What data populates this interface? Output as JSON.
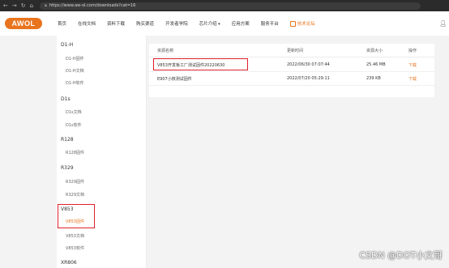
{
  "browser": {
    "url": "https://www.aw-ol.com/downloads?cat=16",
    "nav_icons": [
      "back-icon",
      "forward-icon",
      "reload-icon",
      "home-icon"
    ]
  },
  "header": {
    "logo_text": "AWOL",
    "nav": [
      {
        "label": "首页"
      },
      {
        "label": "在线文档"
      },
      {
        "label": "资料下载"
      },
      {
        "label": "购买渠道"
      },
      {
        "label": "开发者学院"
      },
      {
        "label": "芯片介绍"
      },
      {
        "label": "应用方案"
      },
      {
        "label": "服务平台"
      }
    ],
    "forum_label": "技术论坛",
    "accent": "#e8741e"
  },
  "sidebar": {
    "groups": [
      {
        "label": "D1-H",
        "items": [
          "D1-H固件",
          "D1-H文档",
          "D1-H软件"
        ]
      },
      {
        "label": "D1s",
        "items": [
          "D1s文档",
          "D1s软件"
        ]
      },
      {
        "label": "R128",
        "items": [
          "R128固件"
        ]
      },
      {
        "label": "R329",
        "items": [
          "R329固件",
          "R329文档"
        ]
      },
      {
        "label": "V853",
        "items": [
          "V853固件",
          "V853文档",
          "V853软件"
        ]
      },
      {
        "label": "XR806",
        "items": []
      }
    ],
    "active_item": "V853固件"
  },
  "table": {
    "headers": [
      "资源名称",
      "更新时间",
      "资源大小",
      "操作"
    ],
    "rows": [
      {
        "name": "V853开发板工厂测试固件20220630",
        "time": "2022/06/30 07:07:44",
        "size": "25.46 MB",
        "action": "下载"
      },
      {
        "name": "E907小核测试固件",
        "time": "2022/07/20 05:29:11",
        "size": "239 KB",
        "action": "下载"
      }
    ]
  },
  "watermark": "CSDN @DOT小文哥",
  "highlight_color": "#e0202a"
}
